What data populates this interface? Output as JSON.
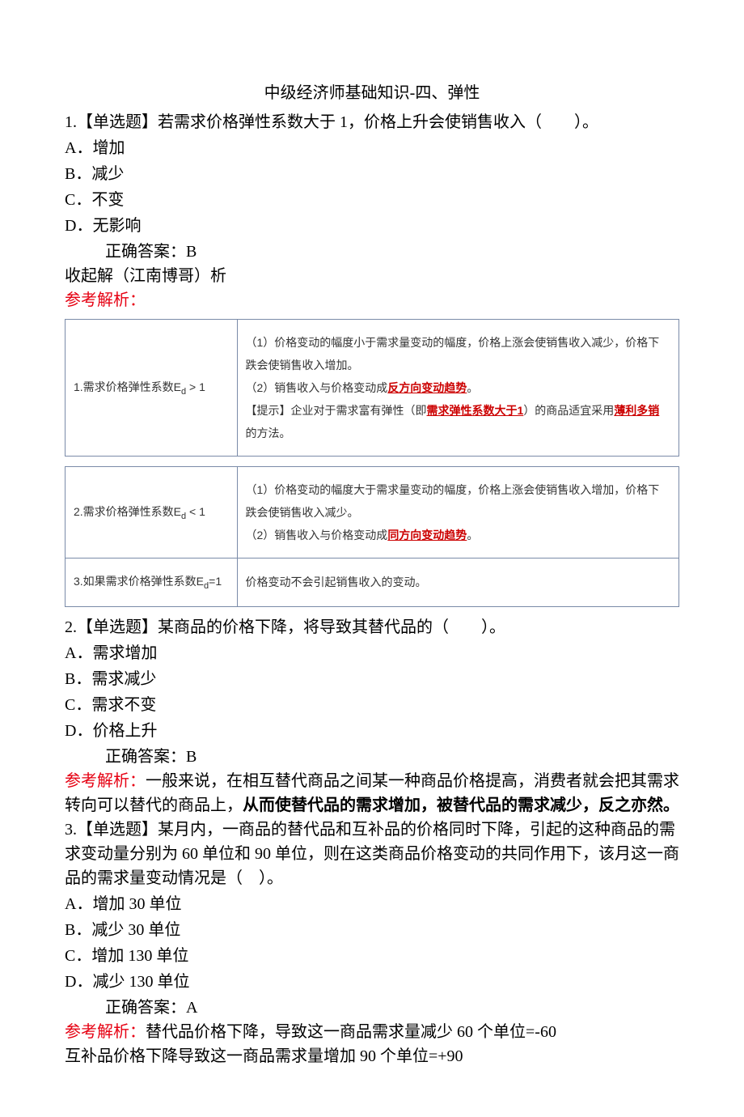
{
  "title": "中级经济师基础知识-四、弹性",
  "q1": {
    "stem": "1.【单选题】若需求价格弹性系数大于 1，价格上升会使销售收入（　　）。",
    "optA": "A．增加",
    "optB": "B．减少",
    "optC": "C．不变",
    "optD": "D．无影响",
    "answer": "正确答案：B",
    "collapse": "收起解（江南博哥）析",
    "analysis_label": "参考解析："
  },
  "table": {
    "row1_left_a": "1.需求价格弹性系数E",
    "row1_left_b": " > 1",
    "row1_r1": "（1）价格变动的幅度小于需求量变动的幅度，价格上涨会使销售收入减少，价格下跌会使销售收入增加。",
    "row1_r2a": "（2）销售收入与价格变动成",
    "row1_r2b": "反方向变动趋势",
    "row1_r2c": "。",
    "row1_r3a": "【提示】企业对于需求富有弹性（即",
    "row1_r3b": "需求弹性系数大于1",
    "row1_r3c": "）的商品适宜采用",
    "row1_r3d": "薄利多销",
    "row1_r3e": "的方法。",
    "row2_left_a": "2.需求价格弹性系数E",
    "row2_left_b": " < 1",
    "row2_r1": "（1）价格变动的幅度大于需求量变动的幅度，价格上涨会使销售收入增加，价格下跌会使销售收入减少。",
    "row2_r2a": "（2）销售收入与价格变动成",
    "row2_r2b": "同方向变动趋势",
    "row2_r2c": "。",
    "row3_left_a": "3.如果需求价格弹性系数E",
    "row3_left_b": "=1",
    "row3_r": "价格变动不会引起销售收入的变动。",
    "d": "d"
  },
  "q2": {
    "stem": "2.【单选题】某商品的价格下降，将导致其替代品的（　　）。",
    "optA": "A．需求增加",
    "optB": "B．需求减少",
    "optC": "C．需求不变",
    "optD": "D．价格上升",
    "answer": "正确答案：B",
    "analysis_label": "参考解析：",
    "analysis_p1": "一般来说，在相互替代商品之间某一种商品价格提高，消费者就会把其需求转向可以替代的商品上，",
    "analysis_p2": "从而使替代品的需求增加，被替代品的需求减少，反之亦然。"
  },
  "q3": {
    "stem": "3.【单选题】某月内，一商品的替代品和互补品的价格同时下降，引起的这种商品的需求变动量分别为 60 单位和 90 单位，则在这类商品价格变动的共同作用下，该月这一商品的需求量变动情况是（　）。",
    "optA": "A．增加 30 单位",
    "optB": "B．减少 30 单位",
    "optC": "C．增加 130 单位",
    "optD": "D．减少 130 单位",
    "answer": "正确答案：A",
    "analysis_label": "参考解析：",
    "analysis_p1": "替代品价格下降，导致这一商品需求量减少 60 个单位=-60",
    "analysis_p2": "互补品价格下降导致这一商品需求量增加 90 个单位=+90"
  }
}
